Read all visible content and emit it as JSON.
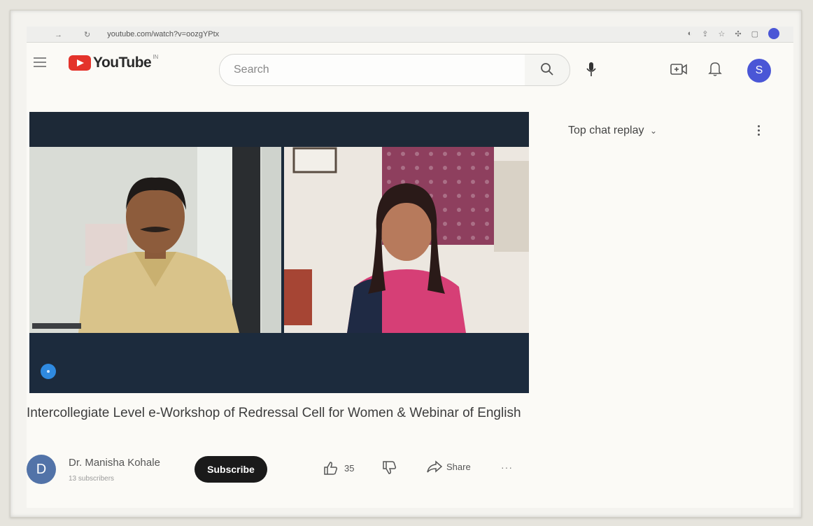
{
  "browser": {
    "url": "youtube.com/watch?v=oozgYPtx",
    "nav_glyphs": "→ ↻"
  },
  "header": {
    "logo_text": "YouTube",
    "country_code": "IN",
    "search_placeholder": "Search",
    "avatar_letter": "S",
    "accent_color": "#e4332b",
    "avatar_color": "#4a56d6"
  },
  "chat": {
    "title": "Top chat replay",
    "chevron": "⌄"
  },
  "video": {
    "title": "Intercollegiate Level e-Workshop of Redressal Cell for Women & Webinar of English"
  },
  "channel": {
    "avatar_letter": "D",
    "name": "Dr. Manisha Kohale",
    "subscribers": "13 subscribers",
    "subscribe_label": "Subscribe"
  },
  "actions": {
    "like_count": "35",
    "share_label": "Share",
    "more_label": "···"
  }
}
